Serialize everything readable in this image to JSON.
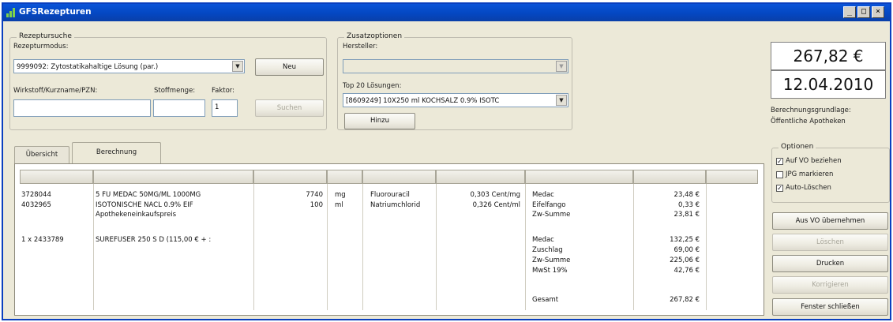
{
  "window": {
    "title": "GFSRezepturen",
    "controls": {
      "minimize": "_",
      "restore": "□",
      "close": "×"
    }
  },
  "search": {
    "group_title": "Rezeptursuche",
    "modus_label": "Rezepturmodus:",
    "modus_value": "9999092: Zytostatikahaltige Lösung (par.)",
    "new_button": "Neu",
    "substance_label": "Wirkstoff/Kurzname/PZN:",
    "substance_value": "",
    "amount_label": "Stoffmenge:",
    "amount_value": "",
    "factor_label": "Faktor:",
    "factor_value": "1",
    "search_button": "Suchen"
  },
  "options_top": {
    "group_title": "Zusatzoptionen",
    "manufacturer_label": "Hersteller:",
    "manufacturer_value": "",
    "top20_label": "Top 20 Lösungen:",
    "top20_value": "[8609249] 10X250 ml KOCHSALZ 0.9% ISOTC",
    "add_button": "Hinzu"
  },
  "summary": {
    "total": "267,82 €",
    "date": "12.04.2010",
    "basis_line1": "Berechnungsgrundlage:",
    "basis_line2": "Öffentliche Apotheken"
  },
  "tabs": [
    "Übersicht",
    "Berechnung"
  ],
  "table": {
    "rows": [
      {
        "pzn": "3728044",
        "name": "5 FU MEDAC 50MG/ML 1000MG",
        "qty": "7740",
        "unit": "mg",
        "substance": "Fluorouracil",
        "price": "0,303 Cent/mg"
      },
      {
        "pzn": "4032965",
        "name": "ISOTONISCHE NACL 0.9% EIF",
        "qty": "100",
        "unit": "ml",
        "substance": "Natriumchlorid",
        "price": "0,326 Cent/ml"
      },
      {
        "pzn": "",
        "name": "Apothekeneinkaufspreis",
        "qty": "",
        "unit": "",
        "substance": "",
        "price": ""
      },
      {
        "pzn": "1 x 2433789",
        "name": "SUREFUSER 250 S D (115,00 € + :",
        "qty": "",
        "unit": "",
        "substance": "",
        "price": ""
      }
    ],
    "costs": [
      {
        "label": "Medac",
        "value": "23,48 €"
      },
      {
        "label": "Eifelfango",
        "value": "0,33 €"
      },
      {
        "label": "Zw-Summe",
        "value": "23,81 €"
      },
      {
        "label": "Medac",
        "value": "132,25 €"
      },
      {
        "label": "Zuschlag",
        "value": "69,00 €"
      },
      {
        "label": "Zw-Summe",
        "value": "225,06 €"
      },
      {
        "label": "MwSt 19%",
        "value": "42,76 €"
      },
      {
        "label": "Gesamt",
        "value": "267,82 €"
      }
    ]
  },
  "options_panel": {
    "group_title": "Optionen",
    "checkboxes": [
      {
        "label": "Auf VO beziehen",
        "checked": true
      },
      {
        "label": "JPG markieren",
        "checked": false
      },
      {
        "label": "Auto-Löschen",
        "checked": true
      }
    ],
    "buttons": {
      "from_vo": "Aus VO übernehmen",
      "delete": "Löschen",
      "print": "Drucken",
      "correct": "Korrigieren",
      "close": "Fenster schließen"
    }
  },
  "colors": {
    "titlebar": "#0a54d8",
    "face": "#ece9d8"
  }
}
